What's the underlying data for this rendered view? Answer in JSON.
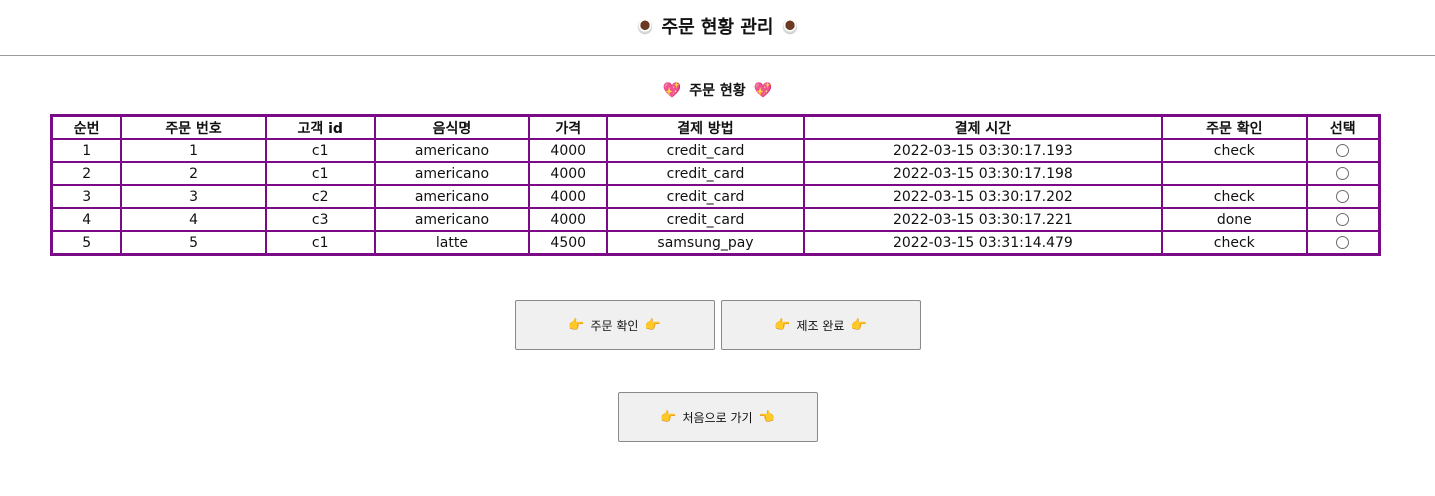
{
  "header": {
    "title": "주문 현황 관리",
    "left_icon": "coffee-icon",
    "right_icon": "coffee-icon"
  },
  "section": {
    "title": "주문 현황",
    "left_icon": "heart-icon",
    "right_icon": "heart-icon"
  },
  "table": {
    "columns": [
      "순번",
      "주문 번호",
      "고객 id",
      "음식명",
      "가격",
      "결제 방법",
      "결제 시간",
      "주문 확인",
      "선택"
    ],
    "rows": [
      [
        "1",
        "1",
        "c1",
        "americano",
        "4000",
        "credit_card",
        "2022-03-15 03:30:17.193",
        "check"
      ],
      [
        "2",
        "2",
        "c1",
        "americano",
        "4000",
        "credit_card",
        "2022-03-15 03:30:17.198",
        ""
      ],
      [
        "3",
        "3",
        "c2",
        "americano",
        "4000",
        "credit_card",
        "2022-03-15 03:30:17.202",
        "check"
      ],
      [
        "4",
        "4",
        "c3",
        "americano",
        "4000",
        "credit_card",
        "2022-03-15 03:30:17.221",
        "done"
      ],
      [
        "5",
        "5",
        "c1",
        "latte",
        "4500",
        "samsung_pay",
        "2022-03-15 03:31:14.479",
        "check"
      ]
    ]
  },
  "buttons": {
    "confirm_label": "주문 확인",
    "complete_label": "제조 완료",
    "home_label": "처음으로 가기"
  },
  "colors": {
    "table_border": "#7a0a86",
    "button_bg": "#f0f0f0"
  }
}
